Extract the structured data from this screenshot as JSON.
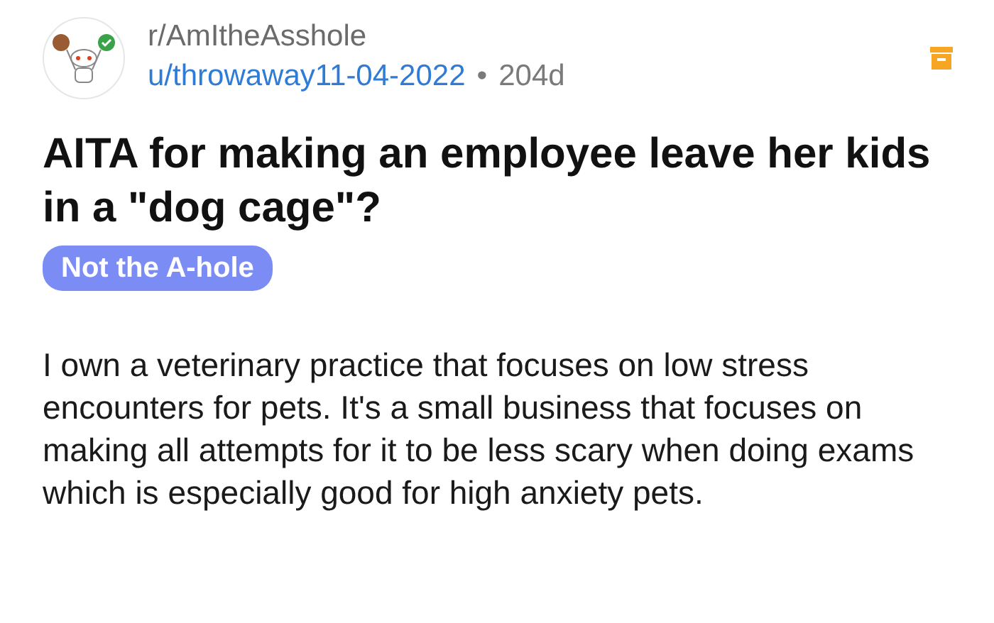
{
  "post": {
    "subreddit": "r/AmItheAsshole",
    "author": "u/throwaway11-04-2022",
    "separator": "•",
    "age": "204d",
    "title": "AITA for making an employee leave her kids in a \"dog cage\"?",
    "flair": "Not the A-hole",
    "body": "I own a veterinary practice that focuses on low stress encounters for pets. It's a small business that focuses on making all attempts for it to be less scary when doing exams which is especially good for high anxiety pets."
  }
}
